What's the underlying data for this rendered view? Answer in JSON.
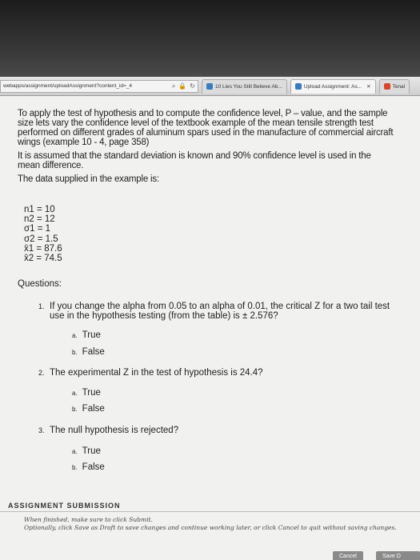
{
  "browser": {
    "url": "webapps/assignment/uploadAssignment?content_id=_4",
    "tabs": [
      {
        "label": "10 Lies You Still Believe Ab..."
      },
      {
        "label": "Upload Assignment: As..."
      },
      {
        "label": "Tenal"
      }
    ]
  },
  "intro": {
    "p1": "To apply the test of hypothesis and to compute the confidence level, P – value, and the sample size lets vary the confidence level of the textbook example of the mean tensile strength test performed on different grades of aluminum spars used in the manufacture of commercial  aircraft wings (example 10 - 4, page 358)",
    "p2": "It is assumed that the standard deviation is known and 90% confidence level is used in the mean difference.",
    "p3": "The data supplied in the example is:"
  },
  "data_values": [
    "n1 = 10",
    "n2 = 12",
    "σ1 = 1",
    "σ2 = 1.5",
    "x̄1 = 87.6",
    "x̄2 = 74.5"
  ],
  "questions_heading": "Questions:",
  "questions": [
    {
      "num": "1.",
      "text": "If you change the alpha from 0.05 to an alpha of 0.01, the critical Z for a two tail test use in the hypothesis testing (from the table) is ± 2.576?",
      "options": [
        {
          "letter": "a.",
          "label": "True"
        },
        {
          "letter": "b.",
          "label": "False"
        }
      ]
    },
    {
      "num": "2.",
      "text": "The experimental Z in the test of hypothesis is 24.4?",
      "options": [
        {
          "letter": "a.",
          "label": "True"
        },
        {
          "letter": "b.",
          "label": "False"
        }
      ]
    },
    {
      "num": "3.",
      "text": "The null hypothesis is rejected?",
      "options": [
        {
          "letter": "a.",
          "label": "True"
        },
        {
          "letter": "b.",
          "label": "False"
        }
      ]
    }
  ],
  "submission": {
    "heading": "ASSIGNMENT SUBMISSION",
    "note1": "When finished, make sure to click Submit.",
    "note2": "Optionally, click Save as Draft to save changes and continue working later, or click Cancel to quit without saving changes.",
    "cancel_label": "Cancel",
    "save_label": "Save D"
  }
}
